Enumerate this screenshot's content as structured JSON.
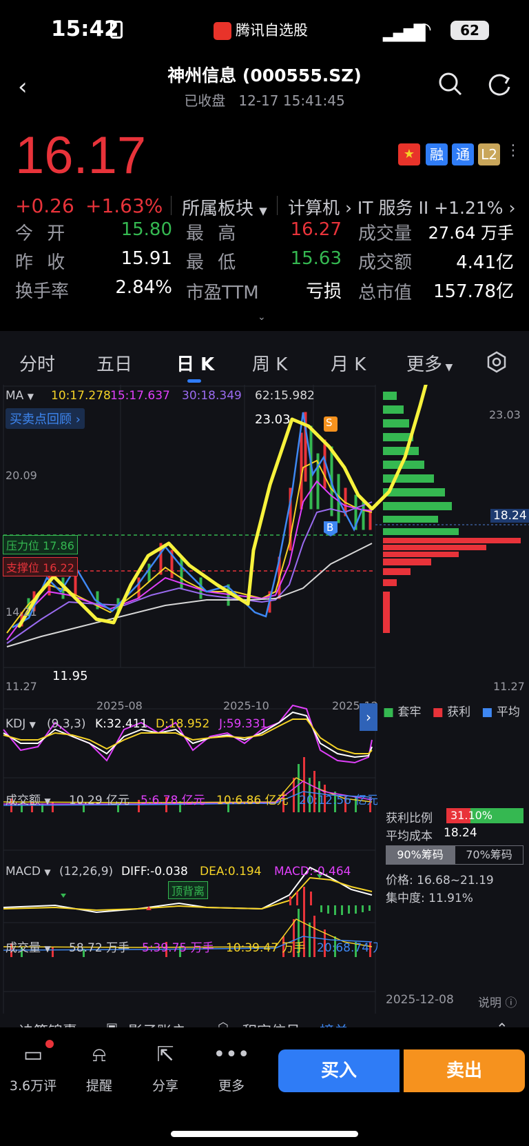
{
  "status": {
    "time": "15:42",
    "app_name": "腾讯自选股",
    "battery": "62"
  },
  "header": {
    "title": "神州信息 (000555.SZ)",
    "state": "已收盘",
    "datetime": "12-17 15:41:45"
  },
  "quote": {
    "price": "16.17",
    "change": "+0.26",
    "change_pct": "+1.63%",
    "sector_label": "所属板块",
    "sector_1": "计算机",
    "sector_2": "IT 服务 II",
    "sector_pct": "+1.21%",
    "tags": [
      "融",
      "通",
      "L2"
    ],
    "rows": [
      [
        {
          "label": "今  开",
          "value": "15.80",
          "color": "green"
        },
        {
          "label": "最  高",
          "value": "16.27",
          "color": "red"
        },
        {
          "label": "成交量",
          "value": "27.64 万手",
          "color": "white"
        }
      ],
      [
        {
          "label": "昨  收",
          "value": "15.91",
          "color": "white"
        },
        {
          "label": "最  低",
          "value": "15.63",
          "color": "green"
        },
        {
          "label": "成交额",
          "value": "4.41亿",
          "color": "white"
        }
      ],
      [
        {
          "label": "换手率",
          "value": "2.84%",
          "color": "white"
        },
        {
          "label": "市盈TTM",
          "value": "亏损",
          "color": "white"
        },
        {
          "label": "总市值",
          "value": "157.78亿",
          "color": "white"
        }
      ]
    ]
  },
  "tabs": [
    "分时",
    "五日",
    "日 K",
    "周 K",
    "月 K",
    "更多"
  ],
  "ma": {
    "label": "MA",
    "m10": "10:17.278",
    "m15": "15:17.637",
    "m30": "30:18.349",
    "m62": "62:15.982"
  },
  "kchart": {
    "review_btn": "买卖点回顾",
    "high_label": "23.03",
    "low_label": "11.95",
    "y_ticks": [
      "20.09",
      "14.21",
      "11.27"
    ],
    "resistance": "压力位 17.86",
    "support": "支撑位 16.22",
    "x_ticks": [
      "2025-08",
      "2025-10",
      "2025-12"
    ],
    "sell_marker": "S",
    "buy_marker": "B"
  },
  "chip": {
    "top": "23.03",
    "bottom": "11.27",
    "avg_tag": "18.24",
    "legend": [
      "套牢",
      "获利",
      "平均"
    ],
    "profit_ratio_label": "获利比例",
    "profit_ratio": "31.10%",
    "profit_ratio_value": 0.311,
    "avg_cost_label": "平均成本",
    "avg_cost": "18.24",
    "tab90": "90%筹码",
    "tab70": "70%筹码",
    "price_range": "价格: 16.68~21.19",
    "concentration": "集中度: 11.91%",
    "date": "2025-12-08",
    "explain": "说明"
  },
  "kdj": {
    "label": "KDJ",
    "params": "(9,3,3)",
    "k": "K:32.411",
    "d": "D:18.952",
    "j": "J:59.331"
  },
  "amount": {
    "label": "成交额",
    "v": "10.29 亿元",
    "m5": "5:6.78 亿元",
    "m10": "10:6.86 亿元",
    "m20": "20:12.56 亿元"
  },
  "macd": {
    "label": "MACD",
    "params": "(12,26,9)",
    "diff": "DIFF:-0.038",
    "dea": "DEA:0.194",
    "macd": "MACD:-0.464",
    "badge": "顶背离"
  },
  "volume": {
    "label": "成交量",
    "v": "58.72 万手",
    "m5": "5:39.75 万手",
    "m10": "10:39.47 万手",
    "m20": "20:68.74 万"
  },
  "footer_links": [
    "决策锦囊",
    "影子账户",
    "积突信号·",
    "榜单"
  ],
  "bottombar": {
    "comments": "3.6万评",
    "remind": "提醒",
    "share": "分享",
    "more": "更多",
    "buy": "买入",
    "sell": "卖出"
  }
}
